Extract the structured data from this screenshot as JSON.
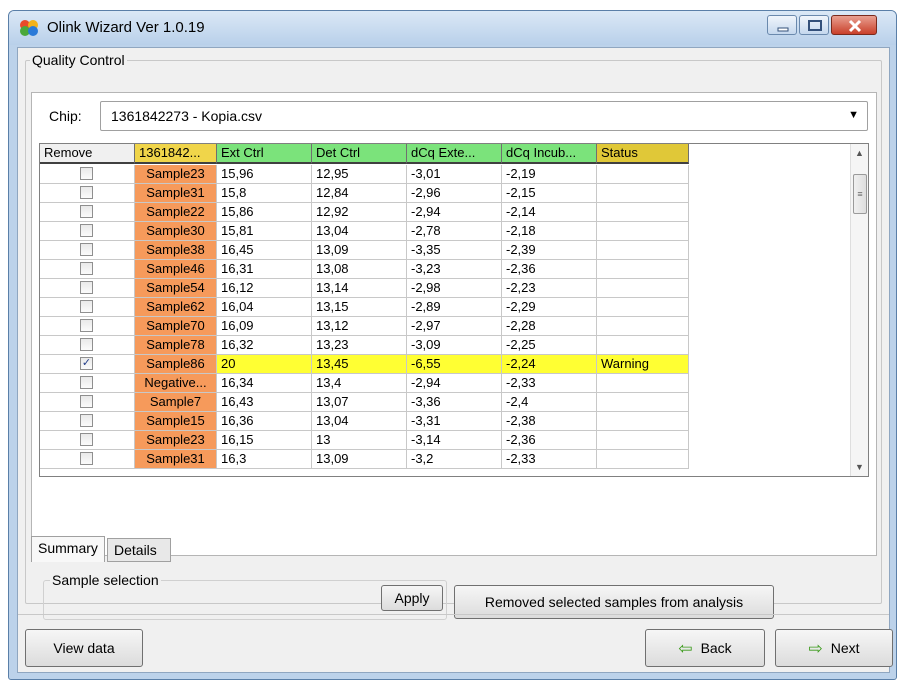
{
  "window": {
    "title": "Olink Wizard Ver 1.0.19",
    "app_icon": "olink-app-icon"
  },
  "quality_control": {
    "legend": "Quality Control",
    "chip_label": "Chip:",
    "chip_value": "1361842273 - Kopia.csv"
  },
  "grid": {
    "headers": [
      "Remove",
      "1361842...",
      "Ext Ctrl",
      "Det Ctrl",
      "dCq Exte...",
      "dCq Incub...",
      "Status"
    ],
    "header_colors": [
      "#f0f0f0",
      "#f0d54a",
      "#7be37b",
      "#7be37b",
      "#7be37b",
      "#7be37b",
      "#e0c838"
    ],
    "sample_color": "#f69a5b",
    "warning_color": "#ffff33",
    "rows": [
      {
        "checked": false,
        "sample": "Sample23",
        "ext": "15,96",
        "det": "12,95",
        "dext": "-3,01",
        "dinc": "-2,19",
        "status": "",
        "warning": false
      },
      {
        "checked": false,
        "sample": "Sample31",
        "ext": "15,8",
        "det": "12,84",
        "dext": "-2,96",
        "dinc": "-2,15",
        "status": "",
        "warning": false
      },
      {
        "checked": false,
        "sample": "Sample22",
        "ext": "15,86",
        "det": "12,92",
        "dext": "-2,94",
        "dinc": "-2,14",
        "status": "",
        "warning": false
      },
      {
        "checked": false,
        "sample": "Sample30",
        "ext": "15,81",
        "det": "13,04",
        "dext": "-2,78",
        "dinc": "-2,18",
        "status": "",
        "warning": false
      },
      {
        "checked": false,
        "sample": "Sample38",
        "ext": "16,45",
        "det": "13,09",
        "dext": "-3,35",
        "dinc": "-2,39",
        "status": "",
        "warning": false
      },
      {
        "checked": false,
        "sample": "Sample46",
        "ext": "16,31",
        "det": "13,08",
        "dext": "-3,23",
        "dinc": "-2,36",
        "status": "",
        "warning": false
      },
      {
        "checked": false,
        "sample": "Sample54",
        "ext": "16,12",
        "det": "13,14",
        "dext": "-2,98",
        "dinc": "-2,23",
        "status": "",
        "warning": false
      },
      {
        "checked": false,
        "sample": "Sample62",
        "ext": "16,04",
        "det": "13,15",
        "dext": "-2,89",
        "dinc": "-2,29",
        "status": "",
        "warning": false
      },
      {
        "checked": false,
        "sample": "Sample70",
        "ext": "16,09",
        "det": "13,12",
        "dext": "-2,97",
        "dinc": "-2,28",
        "status": "",
        "warning": false
      },
      {
        "checked": false,
        "sample": "Sample78",
        "ext": "16,32",
        "det": "13,23",
        "dext": "-3,09",
        "dinc": "-2,25",
        "status": "",
        "warning": false
      },
      {
        "checked": true,
        "sample": "Sample86",
        "ext": "20",
        "det": "13,45",
        "dext": "-6,55",
        "dinc": "-2,24",
        "status": "Warning",
        "warning": true
      },
      {
        "checked": false,
        "sample": "Negative...",
        "ext": "16,34",
        "det": "13,4",
        "dext": "-2,94",
        "dinc": "-2,33",
        "status": "",
        "warning": false
      },
      {
        "checked": false,
        "sample": "Sample7",
        "ext": "16,43",
        "det": "13,07",
        "dext": "-3,36",
        "dinc": "-2,4",
        "status": "",
        "warning": false
      },
      {
        "checked": false,
        "sample": "Sample15",
        "ext": "16,36",
        "det": "13,04",
        "dext": "-3,31",
        "dinc": "-2,38",
        "status": "",
        "warning": false
      },
      {
        "checked": false,
        "sample": "Sample23",
        "ext": "16,15",
        "det": "13",
        "dext": "-3,14",
        "dinc": "-2,36",
        "status": "",
        "warning": false
      },
      {
        "checked": false,
        "sample": "Sample31",
        "ext": "16,3",
        "det": "13,09",
        "dext": "-3,2",
        "dinc": "-2,33",
        "status": "",
        "warning": false
      }
    ]
  },
  "tabs": [
    "Summary",
    "Details"
  ],
  "sample_selection": {
    "legend": "Sample selection",
    "apply_label": "Apply",
    "remove_label": "Removed selected samples from analysis"
  },
  "footer": {
    "view_data_label": "View data",
    "back_label": "Back",
    "next_label": "Next"
  }
}
